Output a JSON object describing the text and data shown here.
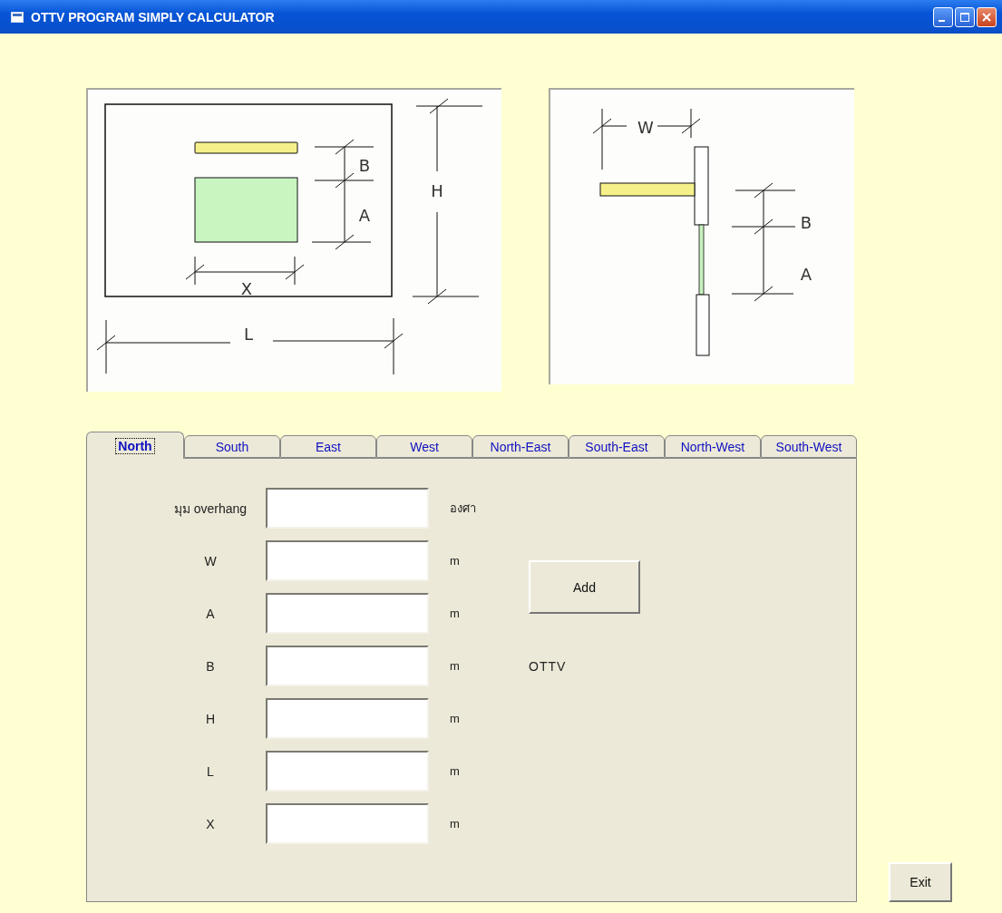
{
  "window": {
    "title": "OTTV PROGRAM SIMPLY CALCULATOR"
  },
  "elevation_diagram": {
    "labels": [
      "B",
      "A",
      "H",
      "X",
      "L"
    ]
  },
  "section_diagram": {
    "labels": [
      "W",
      "B",
      "A"
    ]
  },
  "tabs": [
    {
      "label": "North",
      "selected": true
    },
    {
      "label": "South",
      "selected": false
    },
    {
      "label": "East",
      "selected": false
    },
    {
      "label": "West",
      "selected": false
    },
    {
      "label": "North-East",
      "selected": false
    },
    {
      "label": "South-East",
      "selected": false
    },
    {
      "label": "North-West",
      "selected": false
    },
    {
      "label": "South-West",
      "selected": false
    }
  ],
  "fields": [
    {
      "label": "มุม overhang",
      "unit": "องศา"
    },
    {
      "label": "W",
      "unit": "m"
    },
    {
      "label": "A",
      "unit": "m"
    },
    {
      "label": "B",
      "unit": "m"
    },
    {
      "label": "H",
      "unit": "m"
    },
    {
      "label": "L",
      "unit": "m"
    },
    {
      "label": "X",
      "unit": "m"
    }
  ],
  "add_button": "Add",
  "result_label": "OTTV",
  "exit_button": "Exit"
}
